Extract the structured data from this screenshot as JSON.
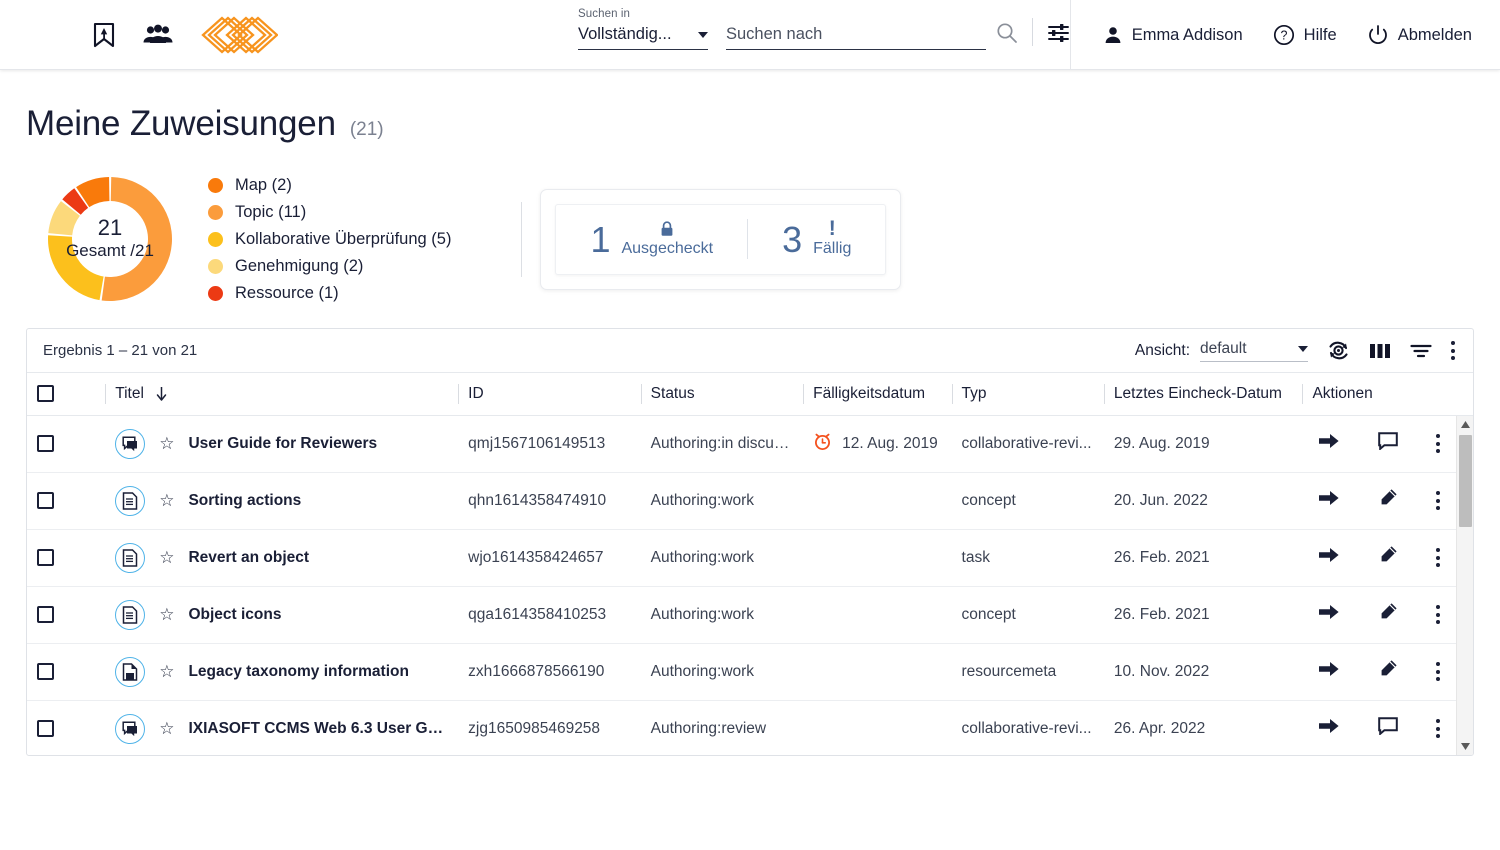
{
  "header": {
    "icons": [
      "menu-icon",
      "bookmark-icon",
      "people-icon",
      "logo-icon"
    ],
    "search": {
      "scope_label": "Suchen in",
      "scope_value": "Vollständig...",
      "query_value": "",
      "query_placeholder": "Suchen nach"
    },
    "user_name": "Emma Addison",
    "help_label": "Hilfe",
    "logout_label": "Abmelden"
  },
  "page": {
    "title": "Meine Zuweisungen",
    "count": "(21)"
  },
  "chart_data": {
    "type": "pie",
    "title": "Meine Zuweisungen",
    "center_total": "21",
    "center_sub": "Gesamt /21",
    "total": 21,
    "legend_position": "right",
    "categories": [
      "Map",
      "Topic",
      "Kollaborative Überprüfung",
      "Genehmigung",
      "Ressource"
    ],
    "values": [
      2,
      11,
      5,
      2,
      1
    ],
    "colors": [
      "#f97a0b",
      "#fb9c3c",
      "#fcc01c",
      "#fcd97b",
      "#ec3a14"
    ],
    "legend": [
      {
        "label": "Map (2)",
        "color": "#f97a0b"
      },
      {
        "label": "Topic (11)",
        "color": "#fb9c3c"
      },
      {
        "label": "Kollaborative Überprüfung (5)",
        "color": "#fcc01c"
      },
      {
        "label": "Genehmigung (2)",
        "color": "#fcd97b"
      },
      {
        "label": "Ressource (1)",
        "color": "#ec3a14"
      }
    ]
  },
  "stats": [
    {
      "value": "1",
      "label": "Ausgecheckt",
      "icon": "lock-icon"
    },
    {
      "value": "3",
      "label": "Fällig",
      "icon": "exclamation-icon"
    }
  ],
  "table": {
    "result_text": "Ergebnis 1 – 21 von 21",
    "view_label": "Ansicht:",
    "view_value": "default",
    "toolbar_icons": [
      "refresh-icon",
      "columns-icon",
      "filter-icon",
      "more-options-icon"
    ],
    "columns": [
      "Titel",
      "ID",
      "Status",
      "Fälligkeitsdatum",
      "Typ",
      "Letztes Eincheck-Datum",
      "Aktionen"
    ],
    "sort_column": "Titel",
    "sort_direction": "descending",
    "rows": [
      {
        "icon": "comment-doc-icon",
        "title": "User Guide for Reviewers",
        "id": "qmj1567106149513",
        "status": "Authoring:in discus...",
        "due_date": "12. Aug. 2019",
        "overdue": true,
        "type": "collaborative-revi...",
        "last_checkin": "29. Aug. 2019",
        "action_icon": "comment-icon"
      },
      {
        "icon": "document-icon",
        "title": "Sorting actions",
        "id": "qhn1614358474910",
        "status": "Authoring:work",
        "due_date": "",
        "overdue": false,
        "type": "concept",
        "last_checkin": "20. Jun. 2022",
        "action_icon": "edit-icon"
      },
      {
        "icon": "document-icon",
        "title": "Revert an object",
        "id": "wjo1614358424657",
        "status": "Authoring:work",
        "due_date": "",
        "overdue": false,
        "type": "task",
        "last_checkin": "26. Feb. 2021",
        "action_icon": "edit-icon"
      },
      {
        "icon": "document-icon",
        "title": "Object icons",
        "id": "qga1614358410253",
        "status": "Authoring:work",
        "due_date": "",
        "overdue": false,
        "type": "concept",
        "last_checkin": "26. Feb. 2021",
        "action_icon": "edit-icon"
      },
      {
        "icon": "resource-icon",
        "title": "Legacy taxonomy information",
        "id": "zxh1666878566190",
        "status": "Authoring:work",
        "due_date": "",
        "overdue": false,
        "type": "resourcemeta",
        "last_checkin": "10. Nov. 2022",
        "action_icon": "edit-icon"
      },
      {
        "icon": "comment-doc-icon",
        "title": "IXIASOFT CCMS Web 6.3 User Guid...",
        "id": "zjg1650985469258",
        "status": "Authoring:review",
        "due_date": "",
        "overdue": false,
        "type": "collaborative-revi...",
        "last_checkin": "26. Apr. 2022",
        "action_icon": "comment-icon"
      }
    ]
  },
  "colors": {
    "accent_orange": "#f7941e",
    "overdue": "#f4511e",
    "icon_ring": "#4fb3e8",
    "stat_blue": "#4a6b9a"
  }
}
